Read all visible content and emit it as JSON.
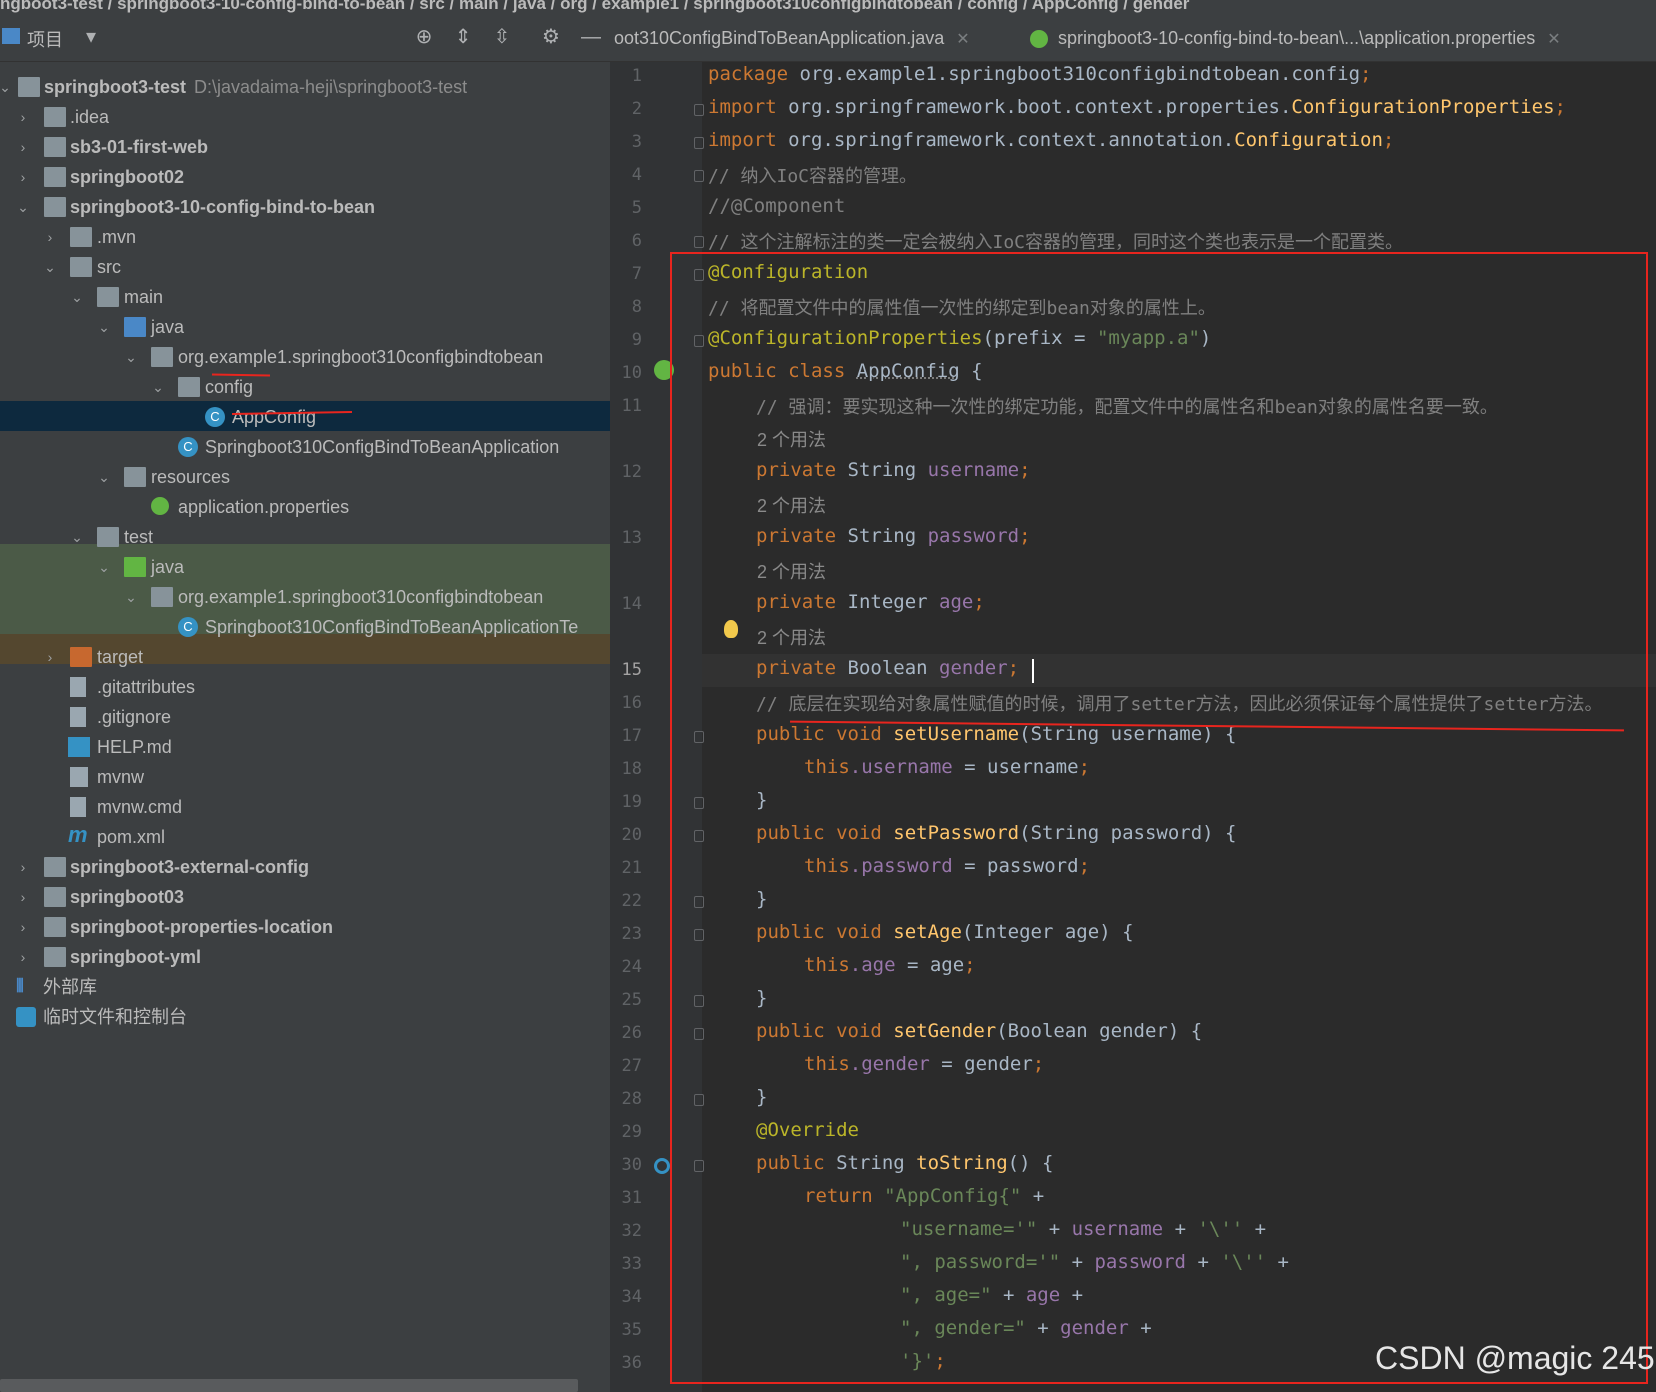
{
  "breadcrumb": "ngboot3-test / springboot3-10-config-bind-to-bean / src / main / java / org / example1 / springboot310configbindtobean / config / AppConfig / gender",
  "project_panel": {
    "title": "项目",
    "root_label": "springboot3-test",
    "root_path": "D:\\javadaima-heji\\springboot3-test",
    "items": [
      {
        "label": ".idea"
      },
      {
        "label": "sb3-01-first-web"
      },
      {
        "label": "springboot02"
      },
      {
        "label": "springboot3-10-config-bind-to-bean"
      },
      {
        "label": ".mvn"
      },
      {
        "label": "src"
      },
      {
        "label": "main"
      },
      {
        "label": "java"
      },
      {
        "label": "org.example1.springboot310configbindtobean"
      },
      {
        "label": "config"
      },
      {
        "label": "AppConfig"
      },
      {
        "label": "Springboot310ConfigBindToBeanApplication"
      },
      {
        "label": "resources"
      },
      {
        "label": "application.properties"
      },
      {
        "label": "test"
      },
      {
        "label": "java"
      },
      {
        "label": "org.example1.springboot310configbindtobean"
      },
      {
        "label": "Springboot310ConfigBindToBeanApplicationTe"
      },
      {
        "label": "target"
      },
      {
        "label": ".gitattributes"
      },
      {
        "label": ".gitignore"
      },
      {
        "label": "HELP.md"
      },
      {
        "label": "mvnw"
      },
      {
        "label": "mvnw.cmd"
      },
      {
        "label": "pom.xml"
      },
      {
        "label": "springboot3-external-config"
      },
      {
        "label": "springboot03"
      },
      {
        "label": "springboot-properties-location"
      },
      {
        "label": "springboot-yml"
      },
      {
        "label": "外部库"
      },
      {
        "label": "临时文件和控制台"
      }
    ]
  },
  "tabs": [
    {
      "label": "oot310ConfigBindToBeanApplication.java"
    },
    {
      "label": "springboot3-10-config-bind-to-bean\\...\\application.properties"
    }
  ],
  "editor": {
    "current_line": "15",
    "usage_hint": "2 个用法",
    "lines": {
      "l1a": "package ",
      "l1b": "org.example1.springboot310configbindtobean.config",
      "l1c": ";",
      "l2a": "import ",
      "l2b": "org.springframework.boot.context.properties.",
      "l2c": "ConfigurationProperties",
      "l2d": ";",
      "l3a": "import ",
      "l3b": "org.springframework.context.annotation.",
      "l3c": "Configuration",
      "l3d": ";",
      "l4": "// 纳入IoC容器的管理。",
      "l5": "//@Component",
      "l6": "// 这个注解标注的类一定会被纳入IoC容器的管理，同时这个类也表示是一个配置类。",
      "l7": "@Configuration",
      "l8": "// 将配置文件中的属性值一次性的绑定到bean对象的属性上。",
      "l9a": "@ConfigurationProperties",
      "l9b": "(prefix = ",
      "l9c": "\"myapp.a\"",
      "l9d": ")",
      "l10a": "public class ",
      "l10b": "AppConfig",
      "l10c": " {",
      "l11": "// 强调：要实现这种一次性的绑定功能，配置文件中的属性名和bean对象的属性名要一致。",
      "l12a": "private ",
      "l12b": "String ",
      "l12c": "username",
      "l12d": ";",
      "l13a": "private ",
      "l13b": "String ",
      "l13c": "password",
      "l13d": ";",
      "l14a": "private ",
      "l14b": "Integer ",
      "l14c": "age",
      "l14d": ";",
      "l15a": "private ",
      "l15b": "Boolean ",
      "l15c": "gender",
      "l15d": ";",
      "l16": "// 底层在实现给对象属性赋值的时候，调用了setter方法，因此必须保证每个属性提供了setter方法。",
      "l17a": "public void ",
      "l17b": "setUsername",
      "l17c": "(String username) {",
      "l18a": "this",
      "l18b": ".username",
      "l18c": " = username",
      "l18d": ";",
      "l19": "}",
      "l20a": "public void ",
      "l20b": "setPassword",
      "l20c": "(String password) {",
      "l21a": "this",
      "l21b": ".password",
      "l21c": " = password",
      "l21d": ";",
      "l22": "}",
      "l23a": "public void ",
      "l23b": "setAge",
      "l23c": "(Integer age) {",
      "l24a": "this",
      "l24b": ".age",
      "l24c": " = age",
      "l24d": ";",
      "l25": "}",
      "l26a": "public void ",
      "l26b": "setGender",
      "l26c": "(Boolean gender) {",
      "l27a": "this",
      "l27b": ".gender",
      "l27c": " = gender",
      "l27d": ";",
      "l28": "}",
      "l29": "@Override",
      "l30a": "public ",
      "l30b": "String ",
      "l30c": "toString",
      "l30d": "() {",
      "l31a": "return ",
      "l31b": "\"AppConfig{\"",
      "l31c": " +",
      "l32a": "\"username='\"",
      "l32b": " + ",
      "l32c": "username",
      "l32d": " + ",
      "l32e": "'\\''",
      "l32f": " +",
      "l33a": "\", password='\"",
      "l33b": " + ",
      "l33c": "password",
      "l33d": " + ",
      "l33e": "'\\''",
      "l33f": " +",
      "l34a": "\", age=\"",
      "l34b": " + ",
      "l34c": "age",
      "l34d": " +",
      "l35a": "\", gender=\"",
      "l35b": " + ",
      "l35c": "gender",
      "l35d": " +",
      "l36a": "'}'",
      "l36b": ";"
    }
  },
  "watermark": "CSDN @magic 245",
  "colors": {
    "accent": "#e8251e",
    "keyword": "#cc7832",
    "string": "#6a8759",
    "field": "#9876aa",
    "method": "#ffc66d"
  }
}
